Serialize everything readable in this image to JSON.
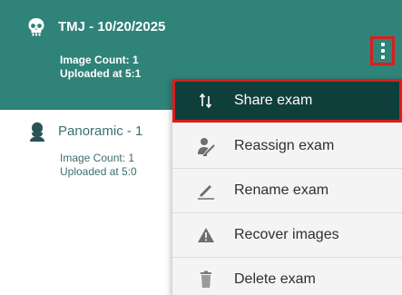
{
  "exams": [
    {
      "title": "TMJ - 10/20/2025",
      "image_count": "Image Count: 1",
      "uploaded": "Uploaded at 5:1",
      "icon": "skull-icon",
      "selected": true
    },
    {
      "title": "Panoramic - 1",
      "image_count": "Image Count: 1",
      "uploaded": "Uploaded at 5:0",
      "icon": "person-icon",
      "selected": false
    }
  ],
  "menu": {
    "items": [
      {
        "label": "Share exam",
        "icon": "share-icon",
        "active": true
      },
      {
        "label": "Reassign exam",
        "icon": "reassign-icon",
        "active": false
      },
      {
        "label": "Rename exam",
        "icon": "pencil-icon",
        "active": false
      },
      {
        "label": "Recover images",
        "icon": "warning-icon",
        "active": false
      },
      {
        "label": "Delete exam",
        "icon": "trash-icon",
        "active": false
      }
    ]
  },
  "colors": {
    "selected_card": "#2f8378",
    "menu_active": "#0f3f3b",
    "highlight_border": "#d91e1e",
    "menu_background": "#f4f4f4"
  }
}
